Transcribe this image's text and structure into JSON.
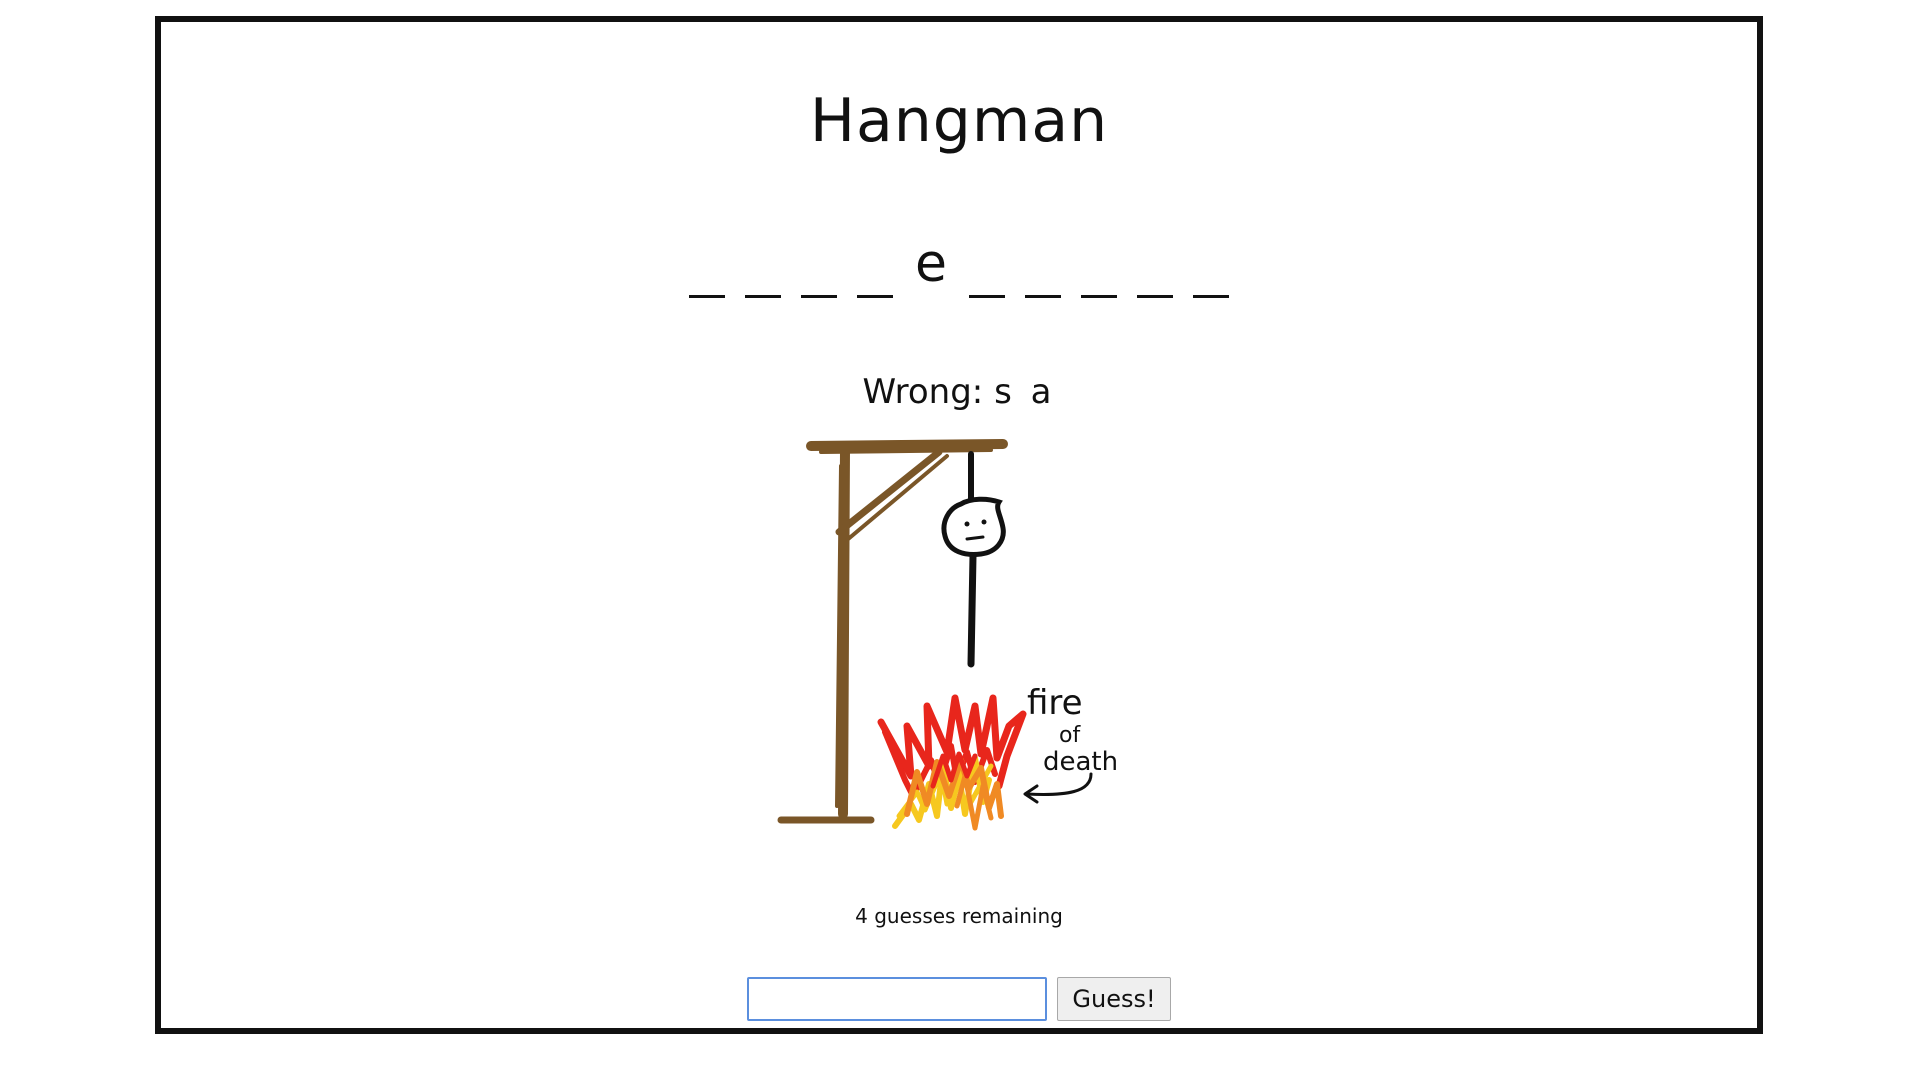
{
  "game": {
    "title": "Hangman",
    "word_slots": [
      "",
      "",
      "",
      "",
      "e",
      "",
      "",
      "",
      "",
      ""
    ],
    "wrong_label": "Wrong:",
    "wrong_letters": "s a",
    "annotation": "fire of death",
    "remaining_text": "4 guesses remaining",
    "guess_input_value": "",
    "guess_button_label": "Guess!"
  },
  "colors": {
    "gallows": "#7a5628",
    "flame_red": "#e8261c",
    "flame_orange": "#f08a24",
    "flame_yellow": "#f6c81f",
    "input_border": "#5b8fde"
  }
}
